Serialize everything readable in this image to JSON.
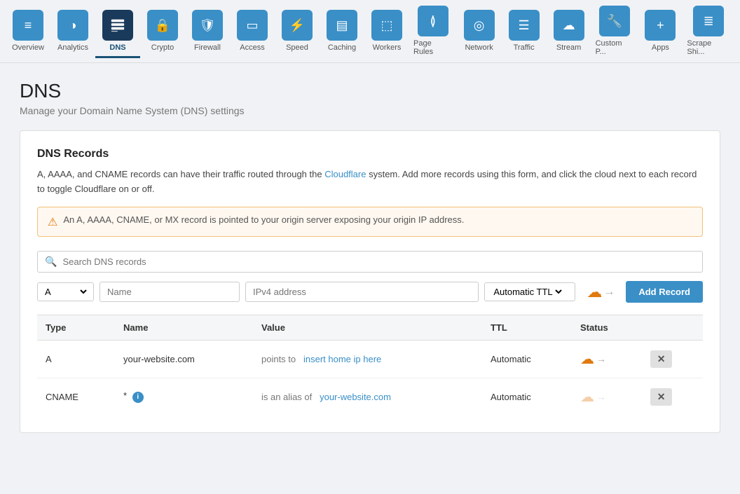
{
  "nav": {
    "items": [
      {
        "id": "overview",
        "label": "Overview",
        "icon": "≡",
        "active": false
      },
      {
        "id": "analytics",
        "label": "Analytics",
        "icon": "◔",
        "active": false
      },
      {
        "id": "dns",
        "label": "DNS",
        "icon": "⊞",
        "active": true
      },
      {
        "id": "crypto",
        "label": "Crypto",
        "icon": "🔒",
        "active": false
      },
      {
        "id": "firewall",
        "label": "Firewall",
        "icon": "🛡",
        "active": false
      },
      {
        "id": "access",
        "label": "Access",
        "icon": "▭",
        "active": false
      },
      {
        "id": "speed",
        "label": "Speed",
        "icon": "⚡",
        "active": false
      },
      {
        "id": "caching",
        "label": "Caching",
        "icon": "▤",
        "active": false
      },
      {
        "id": "workers",
        "label": "Workers",
        "icon": "⬚",
        "active": false
      },
      {
        "id": "pagerules",
        "label": "Page Rules",
        "icon": "≬",
        "active": false
      },
      {
        "id": "network",
        "label": "Network",
        "icon": "◎",
        "active": false
      },
      {
        "id": "traffic",
        "label": "Traffic",
        "icon": "☰",
        "active": false
      },
      {
        "id": "stream",
        "label": "Stream",
        "icon": "☁",
        "active": false
      },
      {
        "id": "customp",
        "label": "Custom P...",
        "icon": "🔧",
        "active": false
      },
      {
        "id": "apps",
        "label": "Apps",
        "icon": "+",
        "active": false
      },
      {
        "id": "scrape",
        "label": "Scrape Shi...",
        "icon": "≣",
        "active": false
      }
    ]
  },
  "page": {
    "title": "DNS",
    "subtitle": "Manage your Domain Name System (DNS) settings"
  },
  "card": {
    "title": "DNS Records",
    "description1": "A, AAAA, and CNAME records can have their traffic routed through the Cloudflare system. Add more records using this form, and click the cloud next to each record to toggle Cloudflare on or off.",
    "warning": "An A, AAAA, CNAME, or MX record is pointed to your origin server exposing your origin IP address."
  },
  "search": {
    "placeholder": "Search DNS records"
  },
  "add_record": {
    "type_default": "A",
    "name_placeholder": "Name",
    "value_placeholder": "IPv4 address",
    "ttl_label": "Automatic TTL",
    "button_label": "Add Record"
  },
  "table": {
    "headers": [
      "Type",
      "Name",
      "Value",
      "TTL",
      "Status"
    ],
    "rows": [
      {
        "type": "A",
        "name": "your-website.com",
        "value_prefix": "points to",
        "value": "insert home ip here",
        "ttl": "Automatic",
        "has_cloud": true,
        "has_delete": true
      },
      {
        "type": "CNAME",
        "name": "*",
        "name_has_info": true,
        "value_prefix": "is an alias of",
        "value": "your-website.com",
        "ttl": "Automatic",
        "has_cloud": false,
        "has_delete": true
      }
    ]
  }
}
